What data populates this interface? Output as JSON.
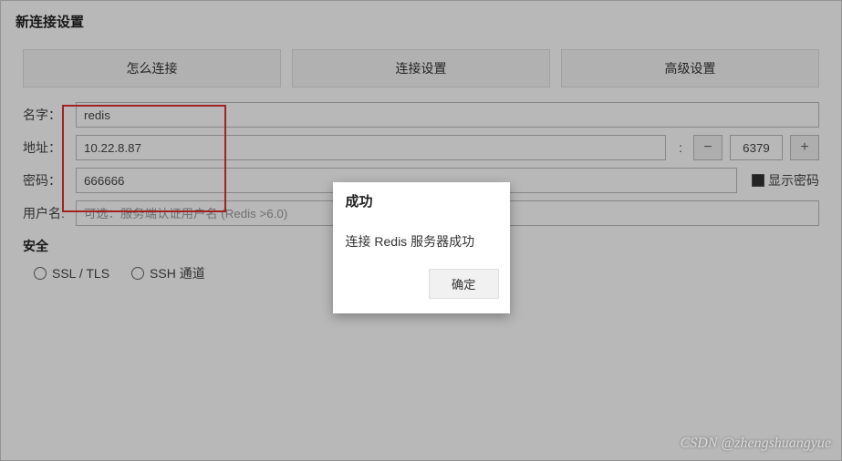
{
  "title": "新连接设置",
  "tabs": {
    "how": "怎么连接",
    "conn": "连接设置",
    "adv": "高级设置"
  },
  "form": {
    "name_label": "名字：",
    "name_value": "redis",
    "addr_label": "地址：",
    "addr_value": "10.22.8.87",
    "port_value": "6379",
    "pass_label": "密码：",
    "pass_value": "666666",
    "show_pass_label": "显示密码",
    "user_label": "用户名:",
    "user_placeholder": "可选：服务端认证用户名 (Redis >6.0)"
  },
  "security": {
    "heading": "安全",
    "ssl_label": "SSL / TLS",
    "ssh_label": "SSH 通道"
  },
  "modal": {
    "title": "成功",
    "message": "连接 Redis 服务器成功",
    "ok": "确定"
  },
  "watermark": "CSDN @zhengshuangyue"
}
